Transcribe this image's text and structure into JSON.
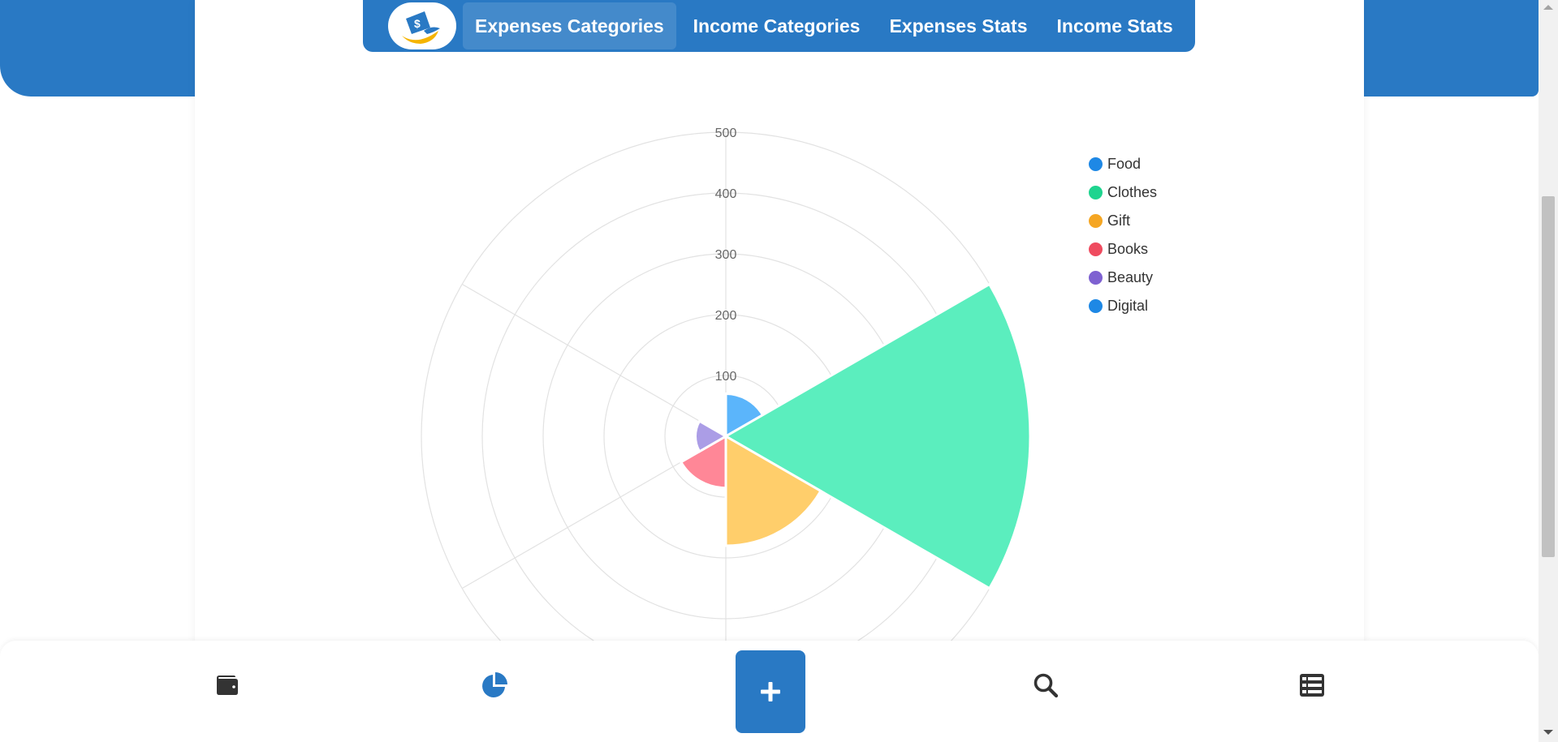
{
  "nav": {
    "logo_icon": "wallet-money-logo",
    "tabs": [
      {
        "label": "Expenses Categories",
        "active": true
      },
      {
        "label": "Income Categories",
        "active": false
      },
      {
        "label": "Expenses Stats",
        "active": false
      },
      {
        "label": "Income Stats",
        "active": false
      }
    ]
  },
  "chart_data": {
    "type": "polarArea",
    "categories": [
      "Food",
      "Clothes",
      "Gift",
      "Books",
      "Beauty",
      "Digital"
    ],
    "values": [
      70,
      500,
      180,
      85,
      50,
      0
    ],
    "colors": [
      "#5bb5fb",
      "#5beebe",
      "#ffce6b",
      "#ff8797",
      "#ab9de6",
      "#5bb5fb"
    ],
    "legend_colors": [
      "#1e88e5",
      "#1ed48f",
      "#f5a623",
      "#ef4b5f",
      "#7e61d1",
      "#1e88e5"
    ],
    "r_ticks": [
      "100",
      "200",
      "300",
      "400",
      "500"
    ],
    "r_max": 500,
    "grid": true,
    "legend_position": "right"
  },
  "bottom_nav": {
    "items": [
      {
        "icon": "wallet-icon"
      },
      {
        "icon": "pie-chart-icon",
        "active": true
      },
      {
        "icon": "plus-icon"
      },
      {
        "icon": "search-icon"
      },
      {
        "icon": "list-icon"
      }
    ]
  },
  "colors": {
    "primary": "#2979c4",
    "icon_dark": "#333333"
  }
}
